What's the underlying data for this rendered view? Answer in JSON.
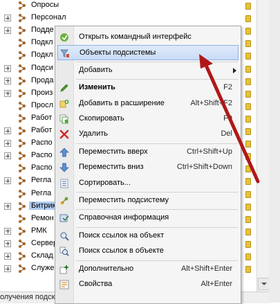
{
  "tree": {
    "items": [
      {
        "label": "Опросы",
        "expandable": false,
        "selected": false
      },
      {
        "label": "Персонал",
        "expandable": true,
        "selected": false
      },
      {
        "label": "Подде",
        "expandable": true,
        "selected": false
      },
      {
        "label": "Подкл",
        "expandable": false,
        "selected": false
      },
      {
        "label": "Подкл",
        "expandable": false,
        "selected": false
      },
      {
        "label": "Подси",
        "expandable": true,
        "selected": false
      },
      {
        "label": "Прода",
        "expandable": true,
        "selected": false
      },
      {
        "label": "Произ",
        "expandable": true,
        "selected": false
      },
      {
        "label": "Просл",
        "expandable": false,
        "selected": false
      },
      {
        "label": "Работ",
        "expandable": false,
        "selected": false
      },
      {
        "label": "Работ",
        "expandable": true,
        "selected": false
      },
      {
        "label": "Распо",
        "expandable": true,
        "selected": false
      },
      {
        "label": "Распо",
        "expandable": true,
        "selected": false
      },
      {
        "label": "Распо",
        "expandable": false,
        "selected": false
      },
      {
        "label": "Регла",
        "expandable": true,
        "selected": false
      },
      {
        "label": "Регла",
        "expandable": false,
        "selected": false
      },
      {
        "label": "Битрик",
        "expandable": true,
        "selected": true
      },
      {
        "label": "Ремон",
        "expandable": false,
        "selected": false
      },
      {
        "label": "РМК",
        "expandable": true,
        "selected": false
      },
      {
        "label": "Сервер",
        "expandable": true,
        "selected": false
      },
      {
        "label": "Склад",
        "expandable": true,
        "selected": false
      },
      {
        "label": "Служе",
        "expandable": true,
        "selected": false
      }
    ]
  },
  "status_bar": {
    "text": "олучения подска"
  },
  "context_menu": {
    "items": [
      {
        "type": "item",
        "label": "Открыть командный интерфейс",
        "shortcut": "",
        "icon": "open-interface-icon",
        "highlighted": false,
        "bold": false,
        "submenu": false
      },
      {
        "type": "item",
        "label": "Объекты подсистемы",
        "shortcut": "",
        "icon": "filter-objects-icon",
        "highlighted": true,
        "bold": false,
        "submenu": false
      },
      {
        "type": "separator"
      },
      {
        "type": "item",
        "label": "Добавить",
        "shortcut": "",
        "icon": "",
        "highlighted": false,
        "bold": false,
        "submenu": true
      },
      {
        "type": "separator"
      },
      {
        "type": "item",
        "label": "Изменить",
        "shortcut": "F2",
        "icon": "pencil-icon",
        "highlighted": false,
        "bold": true,
        "submenu": false
      },
      {
        "type": "item",
        "label": "Добавить в расширение",
        "shortcut": "Alt+Shift+F2",
        "icon": "add-extension-icon",
        "highlighted": false,
        "bold": false,
        "submenu": false
      },
      {
        "type": "item",
        "label": "Скопировать",
        "shortcut": "F9",
        "icon": "copy-icon",
        "highlighted": false,
        "bold": false,
        "submenu": false
      },
      {
        "type": "item",
        "label": "Удалить",
        "shortcut": "Del",
        "icon": "delete-icon",
        "highlighted": false,
        "bold": false,
        "submenu": false
      },
      {
        "type": "separator"
      },
      {
        "type": "item",
        "label": "Переместить вверх",
        "shortcut": "Ctrl+Shift+Up",
        "icon": "move-up-icon",
        "highlighted": false,
        "bold": false,
        "submenu": false
      },
      {
        "type": "item",
        "label": "Переместить вниз",
        "shortcut": "Ctrl+Shift+Down",
        "icon": "move-down-icon",
        "highlighted": false,
        "bold": false,
        "submenu": false
      },
      {
        "type": "item",
        "label": "Сортировать...",
        "shortcut": "",
        "icon": "sort-icon",
        "highlighted": false,
        "bold": false,
        "submenu": false
      },
      {
        "type": "separator"
      },
      {
        "type": "item",
        "label": "Переместить подсистему",
        "shortcut": "",
        "icon": "move-subsystem-icon",
        "highlighted": false,
        "bold": false,
        "submenu": false
      },
      {
        "type": "separator"
      },
      {
        "type": "item",
        "label": "Справочная информация",
        "shortcut": "",
        "icon": "help-info-icon",
        "highlighted": false,
        "bold": false,
        "submenu": false
      },
      {
        "type": "separator"
      },
      {
        "type": "item",
        "label": "Поиск ссылок на объект",
        "shortcut": "",
        "icon": "find-refs-to-icon",
        "highlighted": false,
        "bold": false,
        "submenu": false
      },
      {
        "type": "item",
        "label": "Поиск ссылок в объекте",
        "shortcut": "",
        "icon": "find-refs-in-icon",
        "highlighted": false,
        "bold": false,
        "submenu": false
      },
      {
        "type": "separator"
      },
      {
        "type": "item",
        "label": "Дополнительно",
        "shortcut": "Alt+Shift+Enter",
        "icon": "extra-icon",
        "highlighted": false,
        "bold": false,
        "submenu": false
      },
      {
        "type": "item",
        "label": "Свойства",
        "shortcut": "Alt+Enter",
        "icon": "properties-icon",
        "highlighted": false,
        "bold": false,
        "submenu": false
      }
    ]
  },
  "colors": {
    "selection": "#aecaf0",
    "menu_highlight": "#c9dcf6",
    "annotation_arrow": "#b01818",
    "status_dot": "#e6c23a"
  }
}
